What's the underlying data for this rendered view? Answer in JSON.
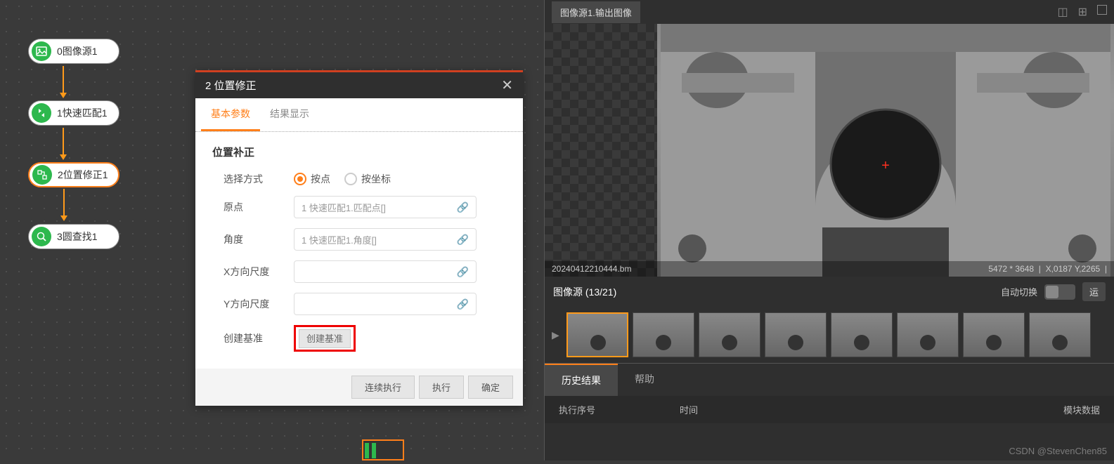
{
  "flow": {
    "nodes": [
      {
        "label": "0图像源1"
      },
      {
        "label": "1快速匹配1"
      },
      {
        "label": "2位置修正1"
      },
      {
        "label": "3圆查找1"
      }
    ]
  },
  "dialog": {
    "title": "2 位置修正",
    "tabs": {
      "basic": "基本参数",
      "result": "结果显示"
    },
    "section": "位置补正",
    "params": {
      "select_mode": {
        "label": "选择方式",
        "opt1": "按点",
        "opt2": "按坐标"
      },
      "origin": {
        "label": "原点",
        "value": "1 快速匹配1.匹配点[]"
      },
      "angle": {
        "label": "角度",
        "value": "1 快速匹配1.角度[]"
      },
      "xscale": {
        "label": "X方向尺度",
        "value": ""
      },
      "yscale": {
        "label": "Y方向尺度",
        "value": ""
      },
      "create_ref": {
        "label": "创建基准",
        "btn": "创建基准"
      }
    },
    "buttons": {
      "continuous": "连续执行",
      "execute": "执行",
      "ok": "确定"
    }
  },
  "viewer": {
    "tab": "图像源1.输出图像",
    "filename": "20240412210444.bm",
    "resolution": "5472 * 3648",
    "coords": "X,0187  Y,2265"
  },
  "gallery": {
    "title": "图像源 (13/21)",
    "auto_switch": "自动切换",
    "run": "运"
  },
  "output": {
    "tabs": {
      "history": "历史结果",
      "help": "帮助"
    },
    "cols": {
      "seq": "执行序号",
      "time": "时间",
      "data": "模块数据"
    }
  },
  "watermark": "CSDN @StevenChen85"
}
